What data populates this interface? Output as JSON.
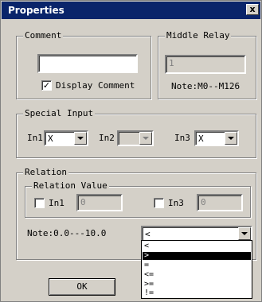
{
  "window": {
    "title": "Properties",
    "close_label": "x"
  },
  "comment": {
    "group_label": "Comment",
    "input_value": "",
    "display_checkbox_checked": true,
    "display_label": "Display Comment"
  },
  "middle_relay": {
    "group_label": "Middle Relay",
    "value": "1",
    "note": "Note:M0--M126"
  },
  "special_input": {
    "group_label": "Special Input",
    "in1_label": "In1",
    "in1_value": "X",
    "in2_label": "In2",
    "in2_value": "",
    "in3_label": "In3",
    "in3_value": "X"
  },
  "relation": {
    "group_label": "Relation",
    "value_group_label": "Relation Value",
    "in1_label": "In1",
    "in1_checked": false,
    "in1_value": "0",
    "in3_label": "In3",
    "in3_checked": false,
    "in3_value": "0",
    "note": "Note:0.0---10.0",
    "operator_value": "<",
    "operator_options": [
      "<",
      ">",
      "=",
      "<=",
      ">=",
      "!="
    ],
    "operator_highlighted_index": 1
  },
  "buttons": {
    "ok_label": "OK"
  }
}
